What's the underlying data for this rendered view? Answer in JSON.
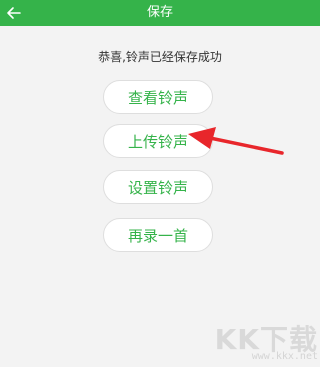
{
  "header": {
    "title": "保存",
    "back_icon": "back-arrow-icon",
    "bg_color": "#35b34a"
  },
  "message": "恭喜,铃声已经保存成功",
  "buttons": [
    {
      "label": "查看铃声"
    },
    {
      "label": "上传铃声"
    },
    {
      "label": "设置铃声"
    },
    {
      "label": "再录一首"
    }
  ],
  "accent_color": "#35b34a",
  "annotation": {
    "icon": "red-arrow-icon",
    "color": "#e8262b"
  },
  "watermark": {
    "brand": "KK下载",
    "url": "www.kkx.net"
  }
}
